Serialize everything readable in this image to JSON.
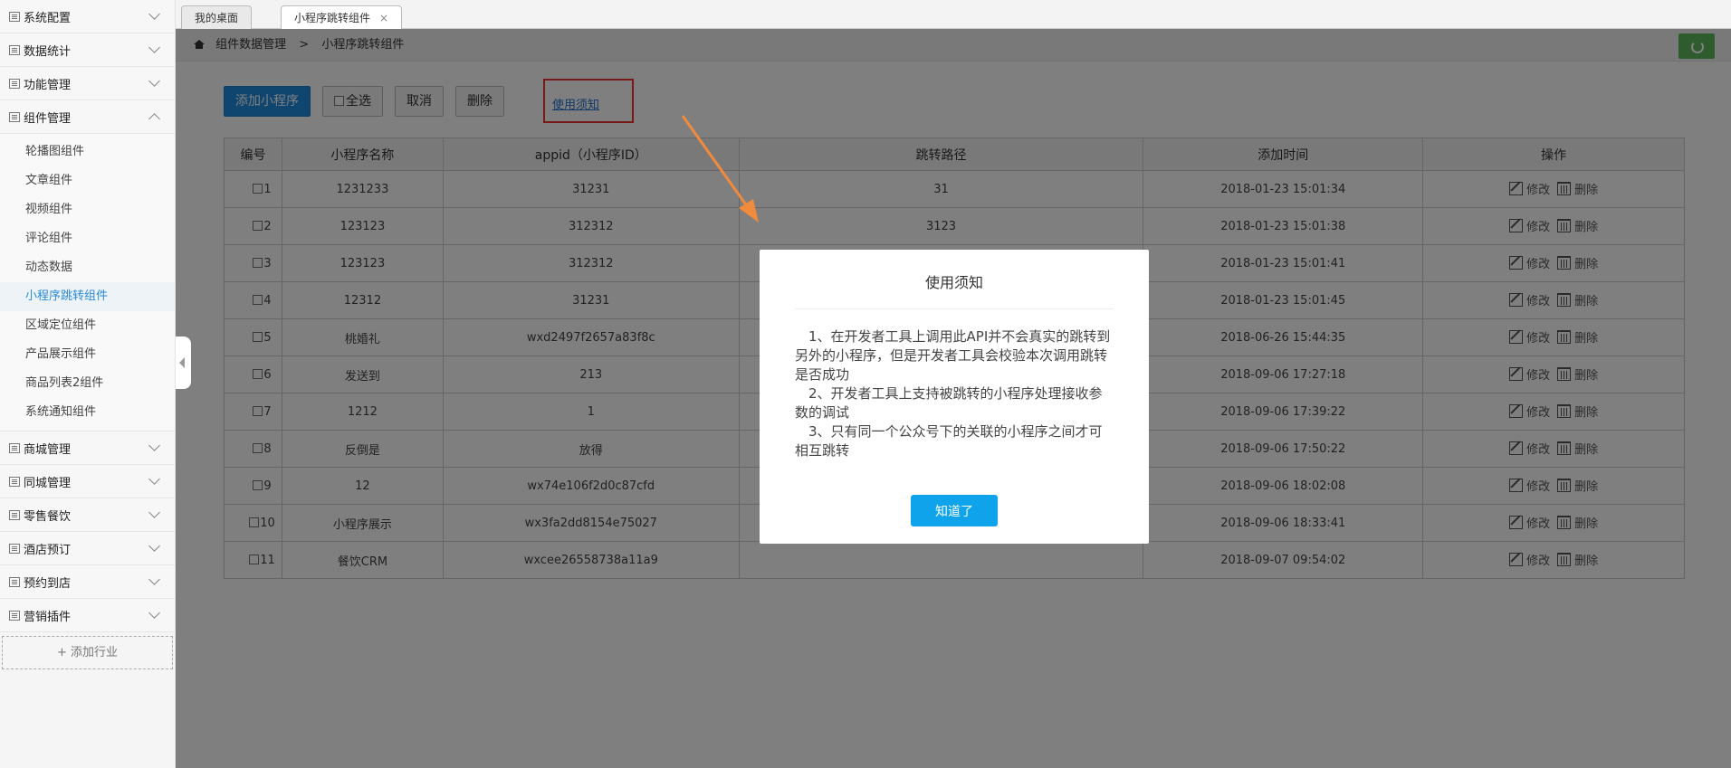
{
  "sidebar": {
    "items_top": [
      {
        "label": "系统配置"
      },
      {
        "label": "数据统计"
      },
      {
        "label": "功能管理"
      }
    ],
    "open_group": {
      "label": "组件管理",
      "children": [
        {
          "label": "轮播图组件"
        },
        {
          "label": "文章组件"
        },
        {
          "label": "视频组件"
        },
        {
          "label": "评论组件"
        },
        {
          "label": "动态数据"
        },
        {
          "label": "小程序跳转组件"
        },
        {
          "label": "区域定位组件"
        },
        {
          "label": "产品展示组件"
        },
        {
          "label": "商品列表2组件"
        },
        {
          "label": "系统通知组件"
        }
      ]
    },
    "items_bottom": [
      {
        "label": "商城管理"
      },
      {
        "label": "同城管理"
      },
      {
        "label": "零售餐饮"
      },
      {
        "label": "酒店预订"
      },
      {
        "label": "预约到店"
      },
      {
        "label": "营销插件"
      }
    ],
    "add_label": "+ 添加行业"
  },
  "tabs": [
    {
      "label": "我的桌面"
    },
    {
      "label": "小程序跳转组件",
      "close": "×"
    }
  ],
  "breadcrumb": {
    "parent": "组件数据管理",
    "sep": ">",
    "current": "小程序跳转组件"
  },
  "toolbar": {
    "add": "添加小程序",
    "select_all": "全选",
    "cancel": "取消",
    "delete": "删除",
    "notice": "使用须知"
  },
  "table": {
    "headers": [
      "编号",
      "小程序名称",
      "appid（小程序ID）",
      "跳转路径",
      "添加时间",
      "操作"
    ],
    "edit_label": "修改",
    "delete_label": "删除",
    "rows": [
      {
        "id": "1",
        "name": "1231233",
        "appid": "31231",
        "path": "31",
        "time": "2018-01-23 15:01:34"
      },
      {
        "id": "2",
        "name": "123123",
        "appid": "312312",
        "path": "3123",
        "time": "2018-01-23 15:01:38"
      },
      {
        "id": "3",
        "name": "123123",
        "appid": "312312",
        "path": "",
        "time": "2018-01-23 15:01:41"
      },
      {
        "id": "4",
        "name": "12312",
        "appid": "31231",
        "path": "",
        "time": "2018-01-23 15:01:45"
      },
      {
        "id": "5",
        "name": "桃婚礼",
        "appid": "wxd2497f2657a83f8c",
        "path": "",
        "time": "2018-06-26 15:44:35"
      },
      {
        "id": "6",
        "name": "发送到",
        "appid": "213",
        "path": "",
        "time": "2018-09-06 17:27:18"
      },
      {
        "id": "7",
        "name": "1212",
        "appid": "1",
        "path": "",
        "time": "2018-09-06 17:39:22"
      },
      {
        "id": "8",
        "name": "反倒是",
        "appid": "放得",
        "path": "",
        "time": "2018-09-06 17:50:22"
      },
      {
        "id": "9",
        "name": "12",
        "appid": "wx74e106f2d0c87cfd",
        "path": "",
        "time": "2018-09-06 18:02:08"
      },
      {
        "id": "10",
        "name": "小程序展示",
        "appid": "wx3fa2dd8154e75027",
        "path": "",
        "time": "2018-09-06 18:33:41"
      },
      {
        "id": "11",
        "name": "餐饮CRM",
        "appid": "wxcee26558738a11a9",
        "path": "",
        "time": "2018-09-07 09:54:02"
      }
    ]
  },
  "modal": {
    "title": "使用须知",
    "lines": [
      "1、在开发者工具上调用此API并不会真实的跳转到另外的小程序，但是开发者工具会校验本次调用跳转是否成功",
      "2、开发者工具上支持被跳转的小程序处理接收参数的调试",
      "3、只有同一个公众号下的关联的小程序之间才可相互跳转"
    ],
    "ok": "知道了"
  },
  "colors": {
    "primary": "#1c8de0",
    "highlight_border": "#e33333",
    "arrow": "#f08a3c",
    "modal_button": "#0ea3ea",
    "refresh": "#5cb85c"
  }
}
